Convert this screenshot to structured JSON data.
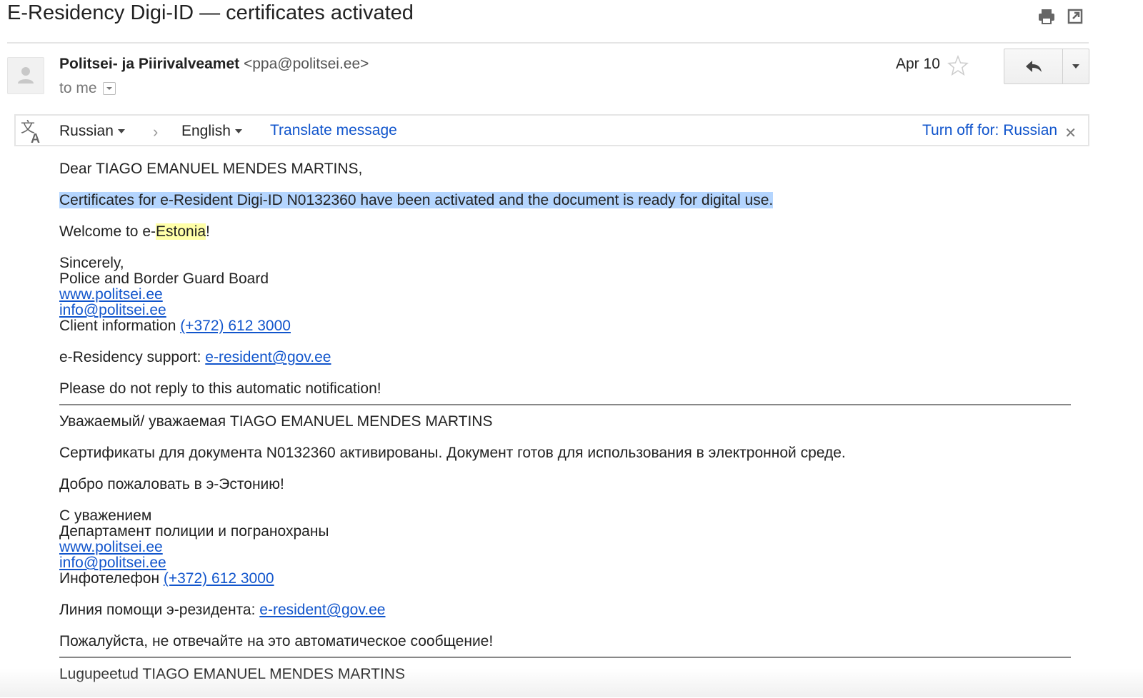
{
  "subject": "E-Residency Digi-ID — certificates activated",
  "header": {
    "sender_name": "Politsei- ja Piirivalveamet",
    "sender_email": "<ppa@politsei.ee>",
    "recipient": "to me",
    "date": "Apr 10",
    "icons": [
      "print-icon",
      "open-new-window-icon",
      "star-icon",
      "reply-icon",
      "more-options-icon"
    ]
  },
  "translate_bar": {
    "source_lang": "Russian",
    "target_lang": "English",
    "translate_link": "Translate message",
    "turn_off": "Turn off for: Russian"
  },
  "body": {
    "en": {
      "greeting": "Dear TIAGO EMANUEL MENDES MARTINS,",
      "certificates": "Certificates for e-Resident Digi-ID N0132360 have been activated and the document is ready for digital use.",
      "welcome_prefix": "Welcome to e-",
      "welcome_highlight": "Estonia",
      "welcome_suffix": "!",
      "sincerely": "Sincerely,",
      "org": "Police and Border Guard Board",
      "website": "www.politsei.ee",
      "email": "info@politsei.ee",
      "client_info_label": "Client information ",
      "phone": "(+372) 612 3000",
      "support_label": "e-Residency support: ",
      "support_email": "e-resident@gov.ee",
      "no_reply": "Please do not reply to this automatic notification!"
    },
    "ru": {
      "greeting": "Уважаемый/ уважаемая TIAGO EMANUEL MENDES MARTINS",
      "certificates": "Сертификаты для документа N0132360 активированы. Документ готов для использования в электронной среде.",
      "welcome": "Добро пожаловать в э-Эстонию!",
      "sincerely": "С уважением",
      "org": "Департамент полиции и погранохраны",
      "website": "www.politsei.ee",
      "email": "info@politsei.ee",
      "client_info_label": "Инфотелефон ",
      "phone": "(+372) 612 3000",
      "support_label": "Линия помощи э-резидента: ",
      "support_email": "e-resident@gov.ee",
      "no_reply": "Пожалуйста, не отвечайте на это автоматическое сообщение!"
    },
    "et": {
      "greeting": "Lugupeetud TIAGO EMANUEL MENDES MARTINS"
    }
  }
}
